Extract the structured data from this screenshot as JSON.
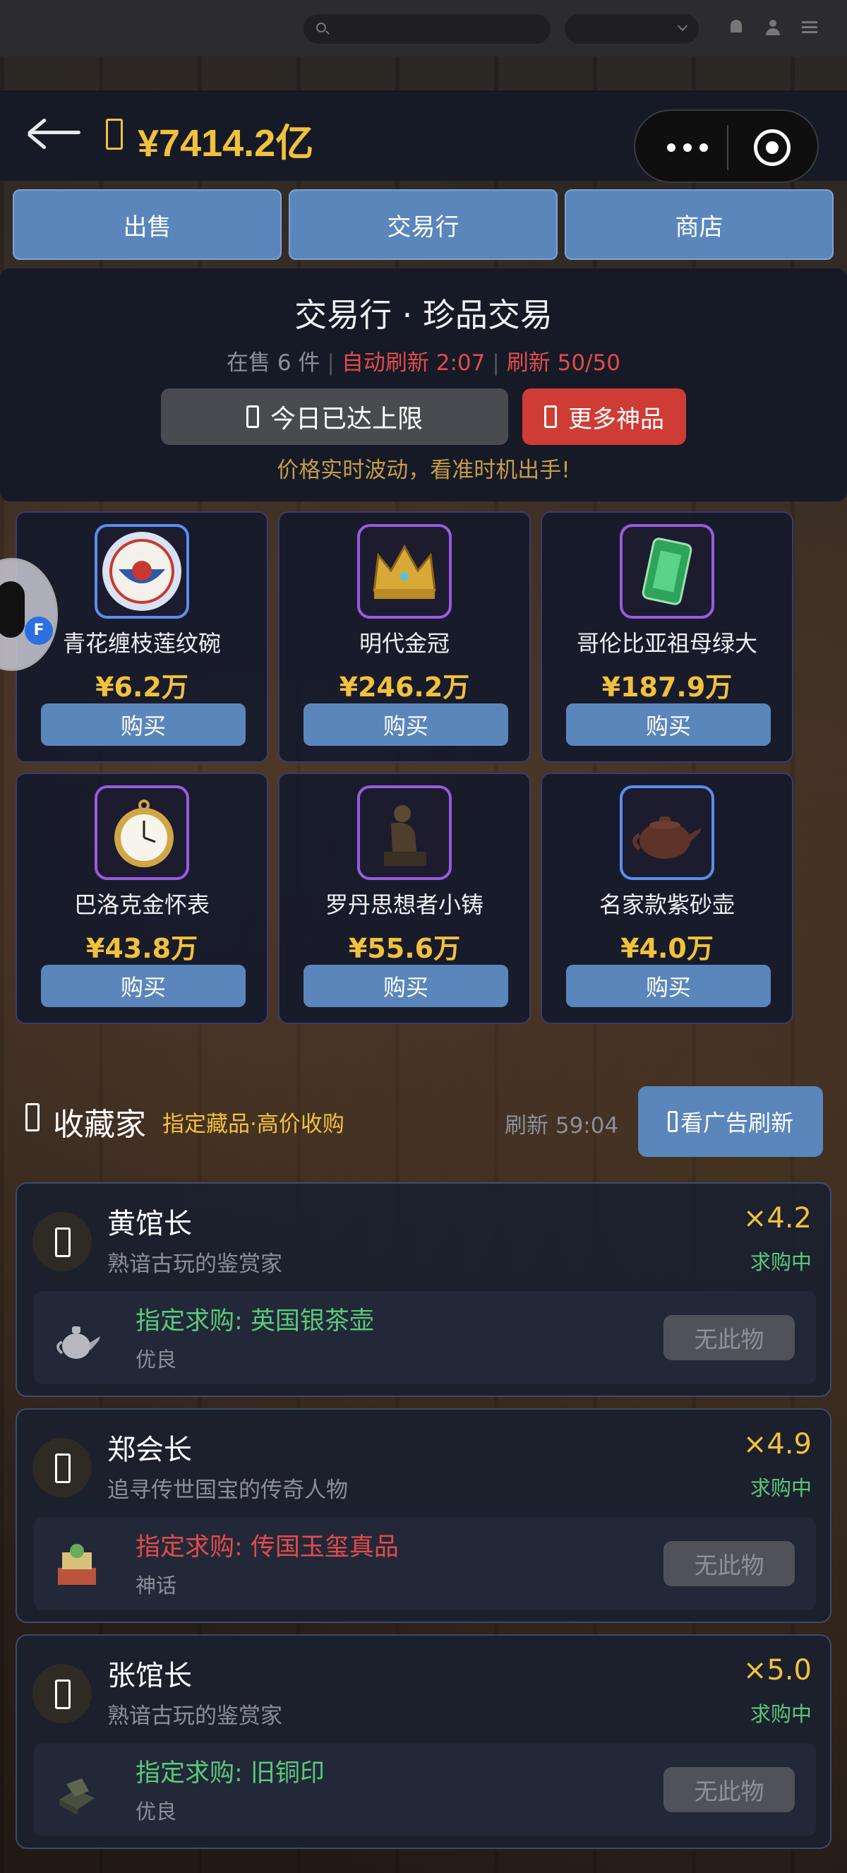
{
  "header": {
    "back_icon": "arrow-left-icon",
    "money": "¥7414.2亿",
    "accent": "#f2c13c"
  },
  "tabs": [
    {
      "label": "出售"
    },
    {
      "label": "交易行"
    },
    {
      "label": "商店"
    }
  ],
  "market": {
    "title": "交易行 · 珍品交易",
    "on_sale": "在售 6 件",
    "auto_refresh": "自动刷新 2:07",
    "refresh_count": "刷新 50/50",
    "limit_button": "今日已达上限",
    "more_button": "更多神品",
    "hint": "价格实时波动，看准时机出手!"
  },
  "items": [
    {
      "name": "青花缠枝莲纹碗",
      "price": "¥6.2万",
      "buy": "购买",
      "rarity": "blue"
    },
    {
      "name": "明代金冠",
      "price": "¥246.2万",
      "buy": "购买",
      "rarity": "purple"
    },
    {
      "name": "哥伦比亚祖母绿大",
      "price": "¥187.9万",
      "buy": "购买",
      "rarity": "purple"
    },
    {
      "name": "巴洛克金怀表",
      "price": "¥43.8万",
      "buy": "购买",
      "rarity": "purple"
    },
    {
      "name": "罗丹思想者小铸",
      "price": "¥55.6万",
      "buy": "购买",
      "rarity": "purple"
    },
    {
      "name": "名家款紫砂壶",
      "price": "¥4.0万",
      "buy": "购买",
      "rarity": "blue"
    }
  ],
  "collectors_section": {
    "title": "收藏家",
    "subtitle": "指定藏品·高价收购",
    "refresh": "刷新 59:04",
    "ad_button": "看广告刷新"
  },
  "collectors": [
    {
      "name": "黄馆长",
      "desc": "熟谙古玩的鉴赏家",
      "multiplier": "×4.2",
      "status": "求购中",
      "want": "指定求购: 英国银茶壶",
      "quality": "优良",
      "button": "无此物"
    },
    {
      "name": "郑会长",
      "desc": "追寻传世国宝的传奇人物",
      "multiplier": "×4.9",
      "status": "求购中",
      "want": "指定求购: 传国玉玺真品",
      "quality": "神话",
      "button": "无此物"
    },
    {
      "name": "张馆长",
      "desc": "熟谙古玩的鉴赏家",
      "multiplier": "×5.0",
      "status": "求购中",
      "want": "指定求购: 旧铜印",
      "quality": "优良",
      "button": "无此物"
    }
  ]
}
